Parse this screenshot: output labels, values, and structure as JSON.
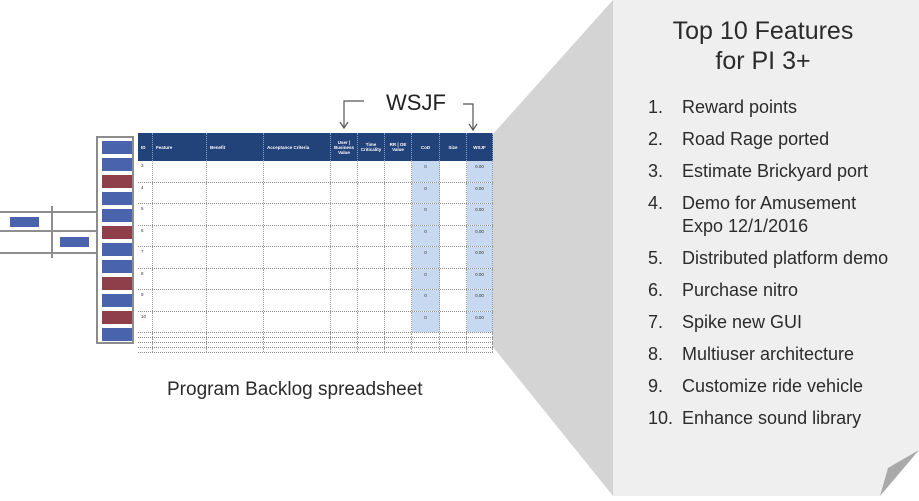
{
  "colors": {
    "header_blue": "#22427a",
    "highlight_blue": "#c6d9f0",
    "stack_blue": "#4a63ad",
    "stack_red": "#8e3f49",
    "panel_gray": "#efefef",
    "wedge_gray": "#d6d6d6"
  },
  "backlog_stack": {
    "items": [
      "blue",
      "blue",
      "red",
      "blue",
      "blue",
      "red",
      "blue",
      "blue",
      "red",
      "blue",
      "red",
      "blue"
    ]
  },
  "spreadsheet": {
    "columns": [
      {
        "label": "ID",
        "align": "left"
      },
      {
        "label": "Feature",
        "align": "left"
      },
      {
        "label": "Benefit",
        "align": "left"
      },
      {
        "label": "Acceptance Criteria",
        "align": "left"
      },
      {
        "label": "User | Business Value",
        "align": "center"
      },
      {
        "label": "Time Criticality",
        "align": "center"
      },
      {
        "label": "RR | OE Value",
        "align": "center"
      },
      {
        "label": "CoD",
        "align": "center"
      },
      {
        "label": "Size",
        "align": "center"
      },
      {
        "label": "WSJF",
        "align": "center"
      }
    ],
    "rows": [
      {
        "id": "3",
        "cod": "0",
        "wsjf": "0.00"
      },
      {
        "id": "4",
        "cod": "0",
        "wsjf": "0.00"
      },
      {
        "id": "5",
        "cod": "0",
        "wsjf": "0.00"
      },
      {
        "id": "6",
        "cod": "0",
        "wsjf": "0.00"
      },
      {
        "id": "7",
        "cod": "0",
        "wsjf": "0.00"
      },
      {
        "id": "8",
        "cod": "0",
        "wsjf": "0.00"
      },
      {
        "id": "9",
        "cod": "0",
        "wsjf": "0.00"
      },
      {
        "id": "10",
        "cod": "0",
        "wsjf": "0.00"
      }
    ],
    "empty_rows": 4,
    "wsjf_label": "WSJF",
    "caption": "Program Backlog spreadsheet"
  },
  "panel": {
    "title_line1": "Top 10 Features",
    "title_line2": "for PI 3+",
    "features": [
      {
        "num": "1.",
        "text": "Reward points"
      },
      {
        "num": "2.",
        "text": "Road Rage ported"
      },
      {
        "num": "3.",
        "text": "Estimate Brickyard port"
      },
      {
        "num": "4.",
        "text": "Demo for Amusement Expo 12/1/2016"
      },
      {
        "num": "5.",
        "text": "Distributed platform demo"
      },
      {
        "num": "6.",
        "text": "Purchase nitro"
      },
      {
        "num": "7.",
        "text": "Spike new GUI"
      },
      {
        "num": "8.",
        "text": "Multiuser architecture"
      },
      {
        "num": "9.",
        "text": "Customize ride vehicle"
      },
      {
        "num": "10.",
        "text": "Enhance sound library"
      }
    ]
  }
}
